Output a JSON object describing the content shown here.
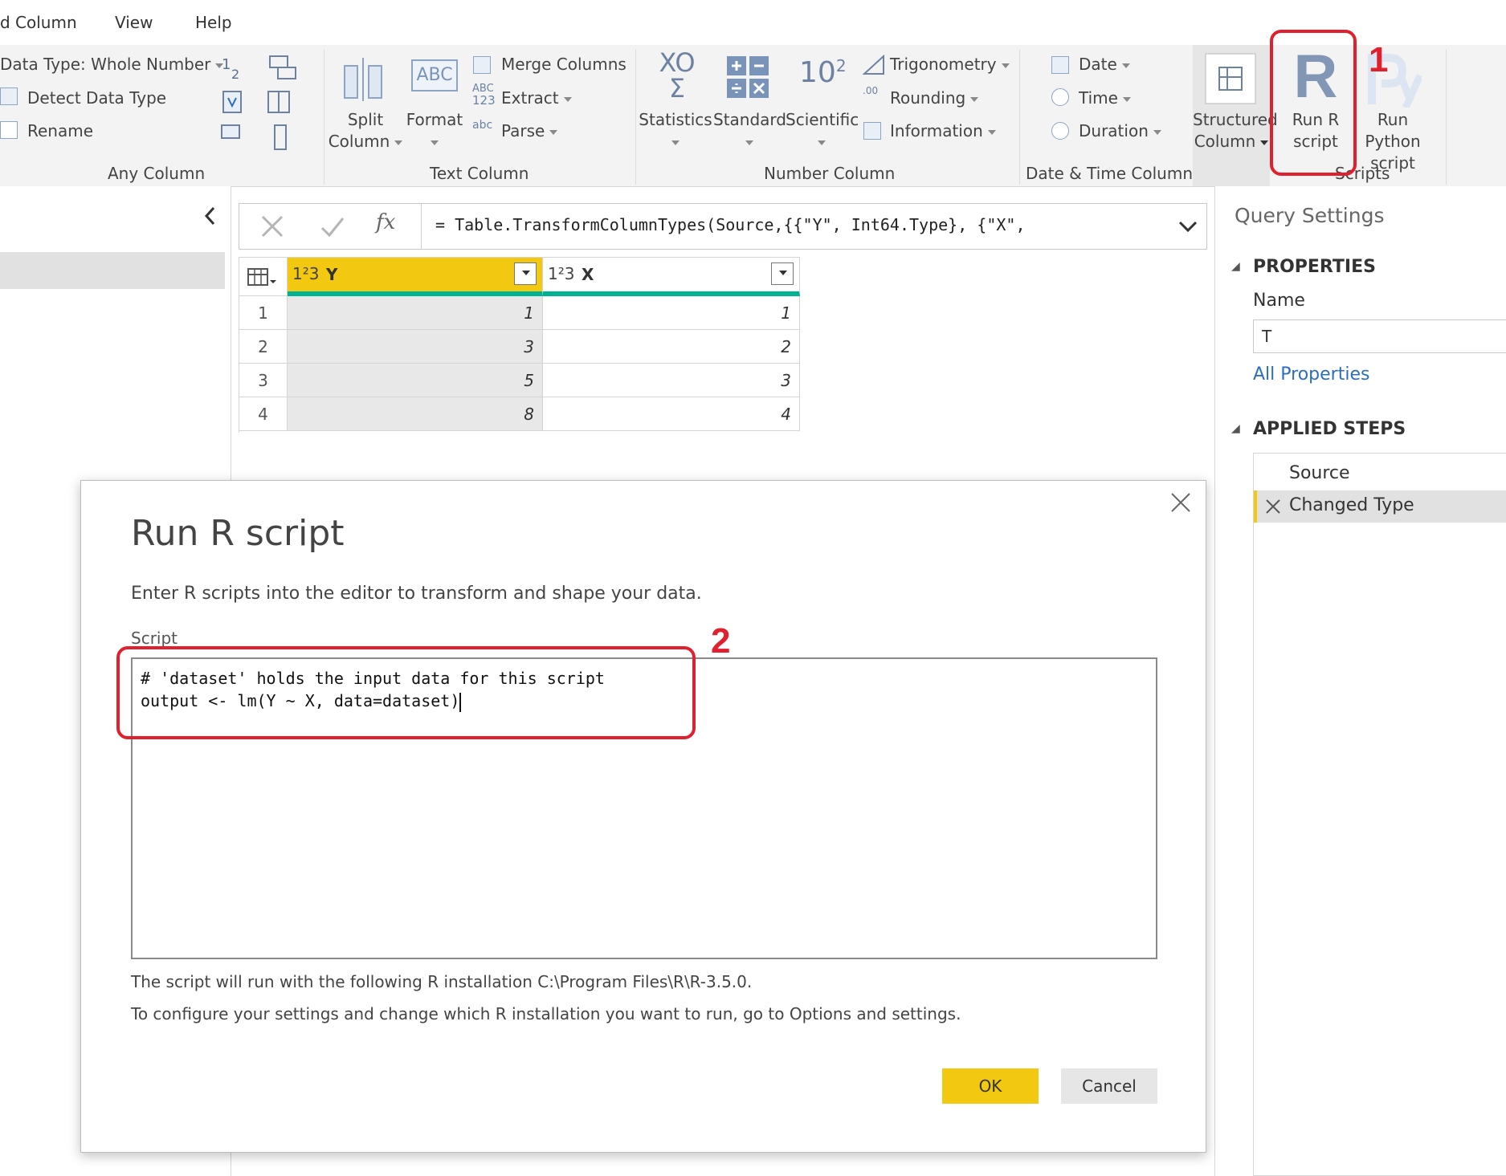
{
  "menu": {
    "items": [
      "d Column",
      "View",
      "Help"
    ]
  },
  "ribbon": {
    "any_column": {
      "data_type_label": "Data Type: Whole Number",
      "detect_label": "Detect Data Type",
      "rename_label": "Rename",
      "group_label": "Any Column"
    },
    "text_column": {
      "split_label_1": "Split",
      "split_label_2": "Column",
      "format_label": "Format",
      "format_icon_text": "ABC",
      "merge_label": "Merge Columns",
      "extract_label": "Extract",
      "extract_icon_text_1": "ABC",
      "extract_icon_text_2": "123",
      "parse_label": "Parse",
      "parse_icon_text": "abc",
      "group_label": "Text Column"
    },
    "number_column": {
      "statistics_glyph_1": "XO",
      "statistics_glyph_2": "Σ",
      "statistics_label": "Statistics",
      "standard_label": "Standard",
      "scientific_glyph": "10",
      "scientific_sup": "2",
      "scientific_label": "Scientific",
      "trig_label": "Trigonometry",
      "rounding_label": "Rounding",
      "rounding_icon_text": ".00",
      "information_label": "Information",
      "group_label": "Number Column"
    },
    "datetime_column": {
      "date_label": "Date",
      "time_label": "Time",
      "duration_label": "Duration",
      "group_label": "Date & Time Column"
    },
    "structured": {
      "label_1": "Structured",
      "label_2": "Column"
    },
    "scripts": {
      "run_r_glyph": "R",
      "run_r_label_1": "Run R",
      "run_r_label_2": "script",
      "run_python_label_1": "Run Python",
      "run_python_label_2": "script",
      "group_label": "Scripts"
    }
  },
  "formula": {
    "text": "= Table.TransformColumnTypes(Source,{{\"Y\", Int64.Type}, {\"X\",",
    "fx_label": "fx"
  },
  "grid": {
    "type_badge": "1²3",
    "columns": [
      "Y",
      "X"
    ],
    "rows": [
      {
        "n": "1",
        "y": "1",
        "x": "1"
      },
      {
        "n": "2",
        "y": "3",
        "x": "2"
      },
      {
        "n": "3",
        "y": "5",
        "x": "3"
      },
      {
        "n": "4",
        "y": "8",
        "x": "4"
      }
    ]
  },
  "query_settings": {
    "title": "Query Settings",
    "properties_heading": "PROPERTIES",
    "name_label": "Name",
    "name_value": "T",
    "all_properties_link": "All Properties",
    "applied_steps_heading": "APPLIED STEPS",
    "steps": [
      "Source",
      "Changed Type"
    ]
  },
  "dialog": {
    "title": "Run R script",
    "description": "Enter R scripts into the editor to transform and shape your data.",
    "script_label": "Script",
    "script_line_1": "# 'dataset' holds the input data for this script",
    "script_line_2": "output <- lm(Y ~ X, data=dataset)",
    "info_line_1": "The script will run with the following R installation C:\\Program Files\\R\\R-3.5.0.",
    "info_line_2": "To configure your settings and change which R installation you want to run, go to Options and settings.",
    "ok_label": "OK",
    "cancel_label": "Cancel"
  },
  "annotations": {
    "marker_1": "1",
    "marker_2": "2"
  },
  "colors": {
    "accent_yellow": "#f2c811",
    "teal": "#00b294",
    "annotation_red": "#e0202f",
    "link_blue": "#2b6ec0"
  }
}
